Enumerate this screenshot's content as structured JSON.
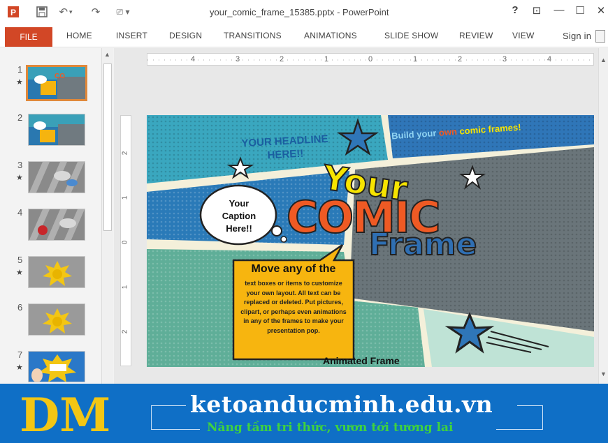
{
  "window": {
    "title": "your_comic_frame_15385.pptx - PowerPoint",
    "help": "?",
    "restore_ribbon": "⊡",
    "minimize": "—",
    "maximize": "☐",
    "close": "✕"
  },
  "quick_access": {
    "undo_label": "↶",
    "redo_label": "↷"
  },
  "ribbon": {
    "tabs": [
      "FILE",
      "HOME",
      "INSERT",
      "DESIGN",
      "TRANSITIONS",
      "ANIMATIONS",
      "SLIDE SHOW",
      "REVIEW",
      "VIEW"
    ],
    "sign_in": "Sign in"
  },
  "ruler": {
    "h_labels": [
      "4",
      "3",
      "2",
      "1",
      "0",
      "1",
      "2",
      "3",
      "4"
    ],
    "v_labels": [
      "2",
      "1",
      "0",
      "1",
      "2"
    ]
  },
  "slides": [
    {
      "number": "1",
      "starred": true,
      "selected": true
    },
    {
      "number": "2",
      "starred": false,
      "selected": false
    },
    {
      "number": "3",
      "starred": true,
      "selected": false
    },
    {
      "number": "4",
      "starred": false,
      "selected": false
    },
    {
      "number": "5",
      "starred": true,
      "selected": false
    },
    {
      "number": "6",
      "starred": false,
      "selected": false
    },
    {
      "number": "7",
      "starred": true,
      "selected": false
    }
  ],
  "slide": {
    "headline": "YOUR HEADLINE HERE!!",
    "banner_text_pre": "Build your",
    "banner_text_own": "own",
    "banner_text_post": "comic frames!",
    "title_your": "Your",
    "title_comic": "COMIC",
    "title_frame": "Frame",
    "caption": "Your Caption Here!!",
    "box_heading": "Move any of the",
    "box_body": "text boxes or items to customize your own layout. All text can be replaced or deleted. Put pictures, clipart, or perhaps even animations in any of the frames to make your presentation pop.",
    "animated_label": "Animated Frame"
  },
  "banner": {
    "site": "ketoanducminh.edu.vn",
    "slogan": "Nâng tầm tri thức, vươn tới tương lai",
    "logo_text": "DM"
  },
  "colors": {
    "file_tab": "#d24726",
    "banner_bg": "#0f6fc6",
    "slogan": "#3fd23f",
    "comic_orange": "#ef5a24",
    "comic_yellow": "#f7e400",
    "comic_blue": "#2f6fb3"
  },
  "icons": [
    "powerpoint-icon",
    "save-icon",
    "undo-icon",
    "redo-icon",
    "customize-icon",
    "help-icon",
    "minimize-icon",
    "maximize-icon",
    "close-icon",
    "star-icon"
  ]
}
